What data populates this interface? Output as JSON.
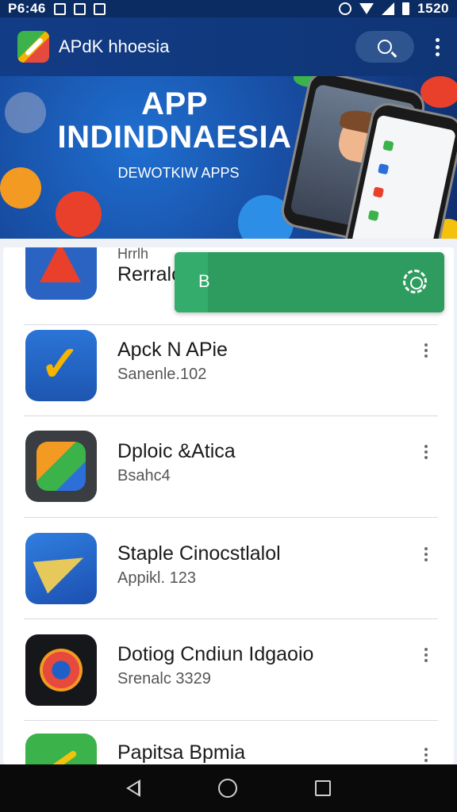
{
  "status_bar": {
    "time": "P6:46",
    "clock_right": "1520"
  },
  "app_bar": {
    "title": "APdK hhoesia"
  },
  "banner": {
    "title_line1": "APP",
    "title_line2": "INDINDNAESIA",
    "subtitle": "DEWOTKIW APPS"
  },
  "apps": [
    {
      "name_partial": "Rerralc",
      "meta_partial": "Hrrlh"
    },
    {
      "name": "Apck N APie",
      "meta": "Sanenle.102"
    },
    {
      "name": "Dploic &Atica",
      "meta": "Bsahc4"
    },
    {
      "name": "Staple Cinocstlalol",
      "meta": "Appikl. 123"
    },
    {
      "name": "Dotiog Cndiun Idgaoio",
      "meta": "Srenalc 3329"
    },
    {
      "name": "Papitsa Bpmia",
      "meta": ""
    }
  ],
  "toast": {
    "label": "B"
  },
  "icons": {
    "search": "search-icon",
    "more": "more-vert-icon",
    "settings": "gear-icon",
    "back": "back-icon",
    "home": "home-icon",
    "recents": "recents-icon"
  },
  "colors": {
    "app_bar": "#123c86",
    "toast": "#2e9c5e",
    "nav_bar": "#0a0a0a"
  }
}
